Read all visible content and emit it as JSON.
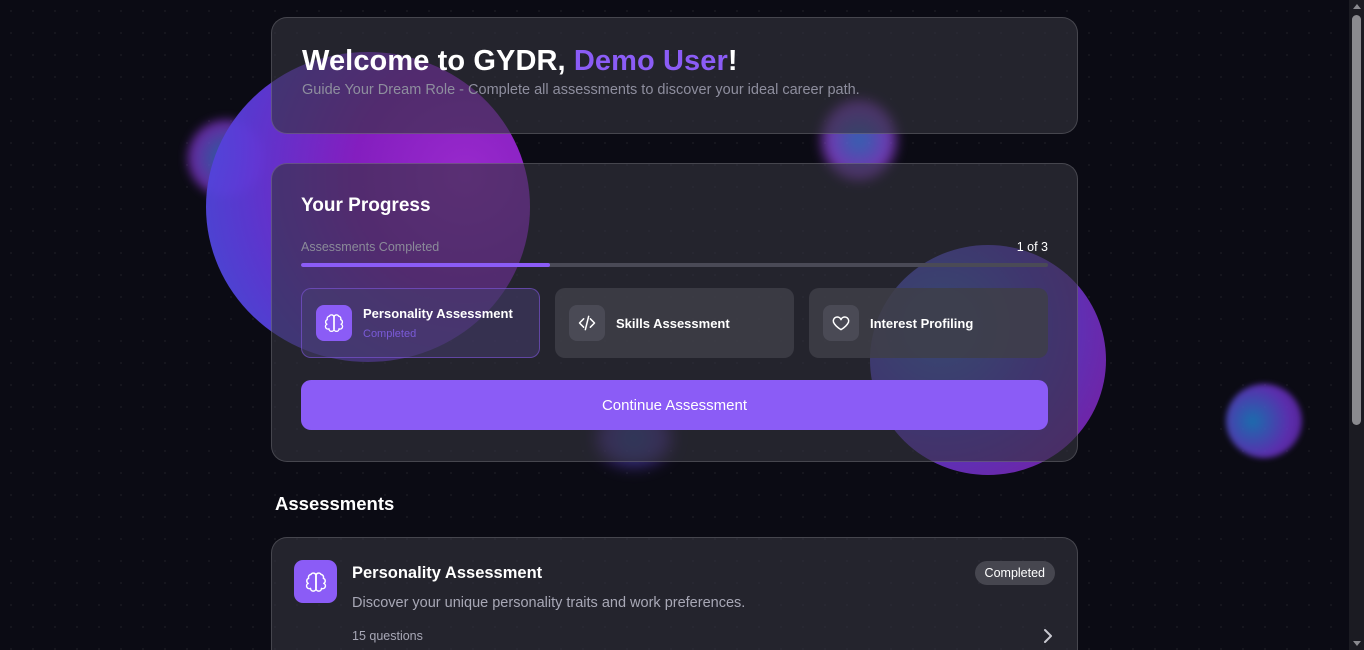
{
  "welcome": {
    "greeting": "Welcome to GYDR, ",
    "user_name": "Demo User",
    "exclaim": "!",
    "subtitle": "Guide Your Dream Role - Complete all assessments to discover your ideal career path."
  },
  "progress": {
    "title": "Your Progress",
    "label": "Assessments Completed",
    "count_text": "1 of 3",
    "completed_fraction": 0.333,
    "steps": [
      {
        "name": "Personality Assessment",
        "status": "Completed",
        "icon": "brain-icon"
      },
      {
        "name": "Skills Assessment",
        "status": "",
        "icon": "code-icon"
      },
      {
        "name": "Interest Profiling",
        "status": "",
        "icon": "heart-icon"
      }
    ],
    "continue_label": "Continue Assessment"
  },
  "assessments": {
    "title": "Assessments",
    "items": [
      {
        "title": "Personality Assessment",
        "description": "Discover your unique personality traits and work preferences.",
        "questions": "15 questions",
        "badge": "Completed",
        "icon": "brain-icon"
      }
    ]
  },
  "colors": {
    "accent": "#8b5cf6",
    "background": "#0b0b14"
  }
}
